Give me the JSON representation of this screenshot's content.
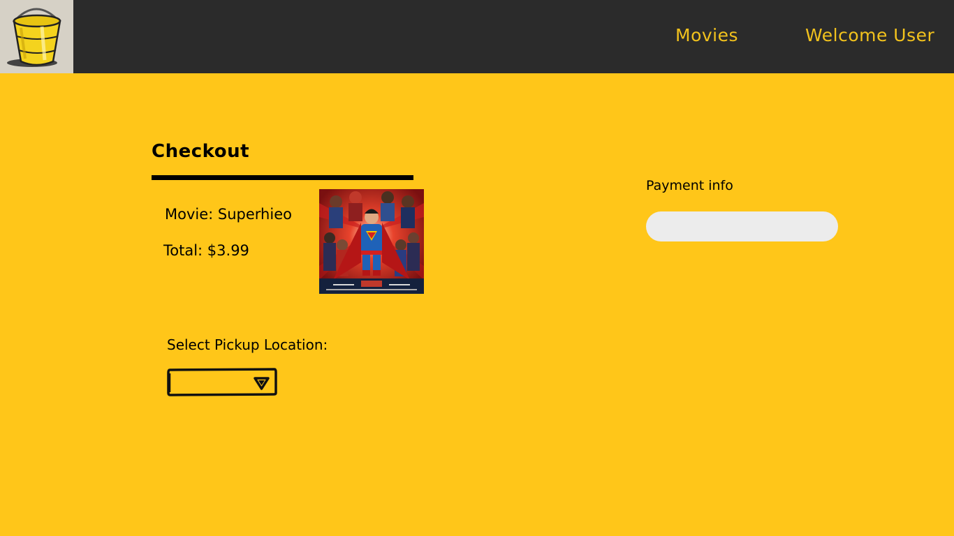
{
  "header": {
    "logo_icon": "bucket-icon",
    "nav": {
      "movies_label": "Movies",
      "user_label": "Welcome User"
    }
  },
  "checkout": {
    "title": "Checkout",
    "movie_label": "Movie: Superhieo",
    "total_label": "Total: $3.99",
    "poster_alt": "Superhero movie poster"
  },
  "pickup": {
    "label": "Select Pickup Location:",
    "selected_value": "",
    "dropdown_icon": "triangle-down-icon"
  },
  "payment": {
    "label": "Payment info",
    "value": "",
    "placeholder": ""
  },
  "colors": {
    "background": "#ffc619",
    "header": "#2b2b2b",
    "nav_text": "#f2c21d",
    "input_bg": "#ececec"
  }
}
